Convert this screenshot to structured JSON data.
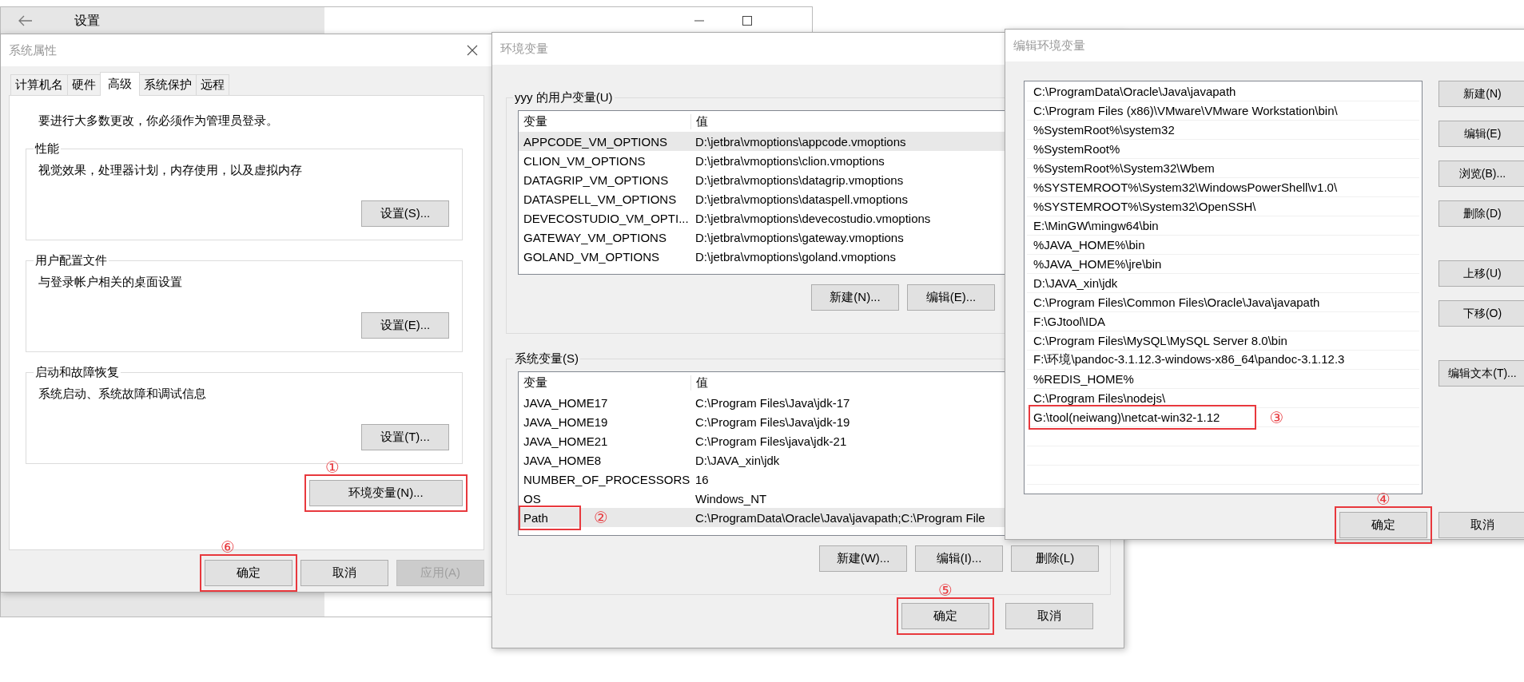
{
  "settings_window": {
    "title": "设置"
  },
  "system_properties": {
    "title": "系统属性",
    "tabs": [
      {
        "label": "计算机名",
        "selected": false
      },
      {
        "label": "硬件",
        "selected": false
      },
      {
        "label": "高级",
        "selected": true
      },
      {
        "label": "系统保护",
        "selected": false
      },
      {
        "label": "远程",
        "selected": false
      }
    ],
    "admin_note": "要进行大多数更改，你必须作为管理员登录。",
    "groups": [
      {
        "title": "性能",
        "description": "视觉效果，处理器计划，内存使用，以及虚拟内存",
        "button": "设置(S)..."
      },
      {
        "title": "用户配置文件",
        "description": "与登录帐户相关的桌面设置",
        "button": "设置(E)..."
      },
      {
        "title": "启动和故障恢复",
        "description": "系统启动、系统故障和调试信息",
        "button": "设置(T)..."
      }
    ],
    "env_button": {
      "label": "环境变量(N)...",
      "annotation": {
        "label": "①"
      }
    },
    "buttons": [
      {
        "label": "确定",
        "disabled": false,
        "annotation": {
          "label": "⑥"
        }
      },
      {
        "label": "取消",
        "disabled": false
      },
      {
        "label": "应用(A)",
        "disabled": true
      }
    ]
  },
  "environment_variables": {
    "title": "环境变量",
    "sections": [
      {
        "title": "yyy 的用户变量(U)",
        "columns": [
          "变量",
          "值"
        ],
        "rows": [
          {
            "name": "APPCODE_VM_OPTIONS",
            "value": "D:\\jetbra\\vmoptions\\appcode.vmoptions",
            "selected": true
          },
          {
            "name": "CLION_VM_OPTIONS",
            "value": "D:\\jetbra\\vmoptions\\clion.vmoptions",
            "selected": false
          },
          {
            "name": "DATAGRIP_VM_OPTIONS",
            "value": "D:\\jetbra\\vmoptions\\datagrip.vmoptions",
            "selected": false
          },
          {
            "name": "DATASPELL_VM_OPTIONS",
            "value": "D:\\jetbra\\vmoptions\\dataspell.vmoptions",
            "selected": false
          },
          {
            "name": "DEVECOSTUDIO_VM_OPTI...",
            "value": "D:\\jetbra\\vmoptions\\devecostudio.vmoptions",
            "selected": false
          },
          {
            "name": "GATEWAY_VM_OPTIONS",
            "value": "D:\\jetbra\\vmoptions\\gateway.vmoptions",
            "selected": false
          },
          {
            "name": "GOLAND_VM_OPTIONS",
            "value": "D:\\jetbra\\vmoptions\\goland.vmoptions",
            "selected": false
          }
        ],
        "buttons": [
          "新建(N)...",
          "编辑(E)..."
        ]
      },
      {
        "title": "系统变量(S)",
        "columns": [
          "变量",
          "值"
        ],
        "rows": [
          {
            "name": "JAVA_HOME17",
            "value": "C:\\Program Files\\Java\\jdk-17",
            "selected": false
          },
          {
            "name": "JAVA_HOME19",
            "value": "C:\\Program Files\\Java\\jdk-19",
            "selected": false
          },
          {
            "name": "JAVA_HOME21",
            "value": "C:\\Program Files\\java\\jdk-21",
            "selected": false
          },
          {
            "name": "JAVA_HOME8",
            "value": "D:\\JAVA_xin\\jdk",
            "selected": false
          },
          {
            "name": "NUMBER_OF_PROCESSORS",
            "value": "16",
            "selected": false
          },
          {
            "name": "OS",
            "value": "Windows_NT",
            "selected": false
          },
          {
            "name": "Path",
            "value": "C:\\ProgramData\\Oracle\\Java\\javapath;C:\\Program File",
            "selected": true,
            "annotation": {
              "label": "②"
            }
          }
        ],
        "buttons": [
          "新建(W)...",
          "编辑(I)...",
          "删除(L)"
        ]
      }
    ],
    "buttons": [
      {
        "label": "确定",
        "annotation": {
          "label": "⑤"
        }
      },
      {
        "label": "取消"
      }
    ]
  },
  "edit_variable": {
    "title": "编辑环境变量",
    "entries": [
      {
        "text": "C:\\ProgramData\\Oracle\\Java\\javapath"
      },
      {
        "text": "C:\\Program Files (x86)\\VMware\\VMware Workstation\\bin\\"
      },
      {
        "text": "%SystemRoot%\\system32"
      },
      {
        "text": "%SystemRoot%"
      },
      {
        "text": "%SystemRoot%\\System32\\Wbem"
      },
      {
        "text": "%SYSTEMROOT%\\System32\\WindowsPowerShell\\v1.0\\"
      },
      {
        "text": "%SYSTEMROOT%\\System32\\OpenSSH\\"
      },
      {
        "text": "E:\\MinGW\\mingw64\\bin"
      },
      {
        "text": "%JAVA_HOME%\\bin"
      },
      {
        "text": "%JAVA_HOME%\\jre\\bin"
      },
      {
        "text": "D:\\JAVA_xin\\jdk"
      },
      {
        "text": "C:\\Program Files\\Common Files\\Oracle\\Java\\javapath"
      },
      {
        "text": "F:\\GJtool\\IDA"
      },
      {
        "text": "C:\\Program Files\\MySQL\\MySQL Server 8.0\\bin"
      },
      {
        "text": "F:\\环境\\pandoc-3.1.12.3-windows-x86_64\\pandoc-3.1.12.3"
      },
      {
        "text": "%REDIS_HOME%"
      },
      {
        "text": "C:\\Program Files\\nodejs\\"
      },
      {
        "text": "G:\\tool(neiwang)\\netcat-win32-1.12",
        "annotation": {
          "label": "③"
        }
      }
    ],
    "side_buttons": [
      [
        "新建(N)",
        "编辑(E)",
        "浏览(B)...",
        "删除(D)"
      ],
      [
        "上移(U)",
        "下移(O)"
      ],
      [
        "编辑文本(T)..."
      ]
    ],
    "buttons": [
      {
        "label": "确定",
        "annotation": {
          "label": "④"
        }
      },
      {
        "label": "取消"
      }
    ]
  }
}
